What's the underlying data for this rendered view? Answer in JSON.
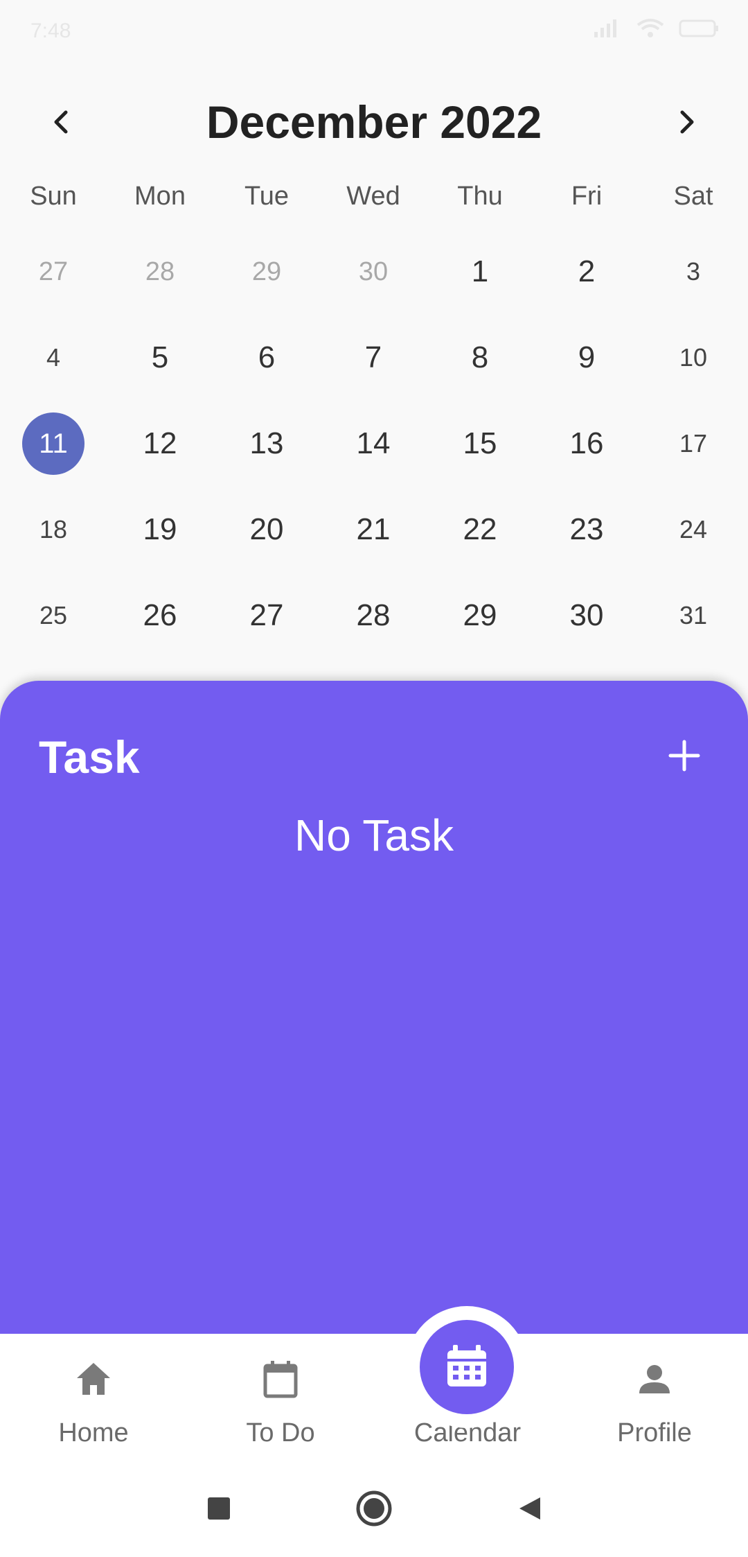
{
  "status_bar": {
    "time": "7:48",
    "icons": [
      "call-icon",
      "dots-icon",
      "signal-icon",
      "wifi-icon",
      "battery-icon"
    ]
  },
  "calendar": {
    "month_title": "December 2022",
    "weekdays": [
      "Sun",
      "Mon",
      "Tue",
      "Wed",
      "Thu",
      "Fri",
      "Sat"
    ],
    "weeks": [
      [
        "27",
        "28",
        "29",
        "30",
        "1",
        "2",
        "3"
      ],
      [
        "4",
        "5",
        "6",
        "7",
        "8",
        "9",
        "10"
      ],
      [
        "11",
        "12",
        "13",
        "14",
        "15",
        "16",
        "17"
      ],
      [
        "18",
        "19",
        "20",
        "21",
        "22",
        "23",
        "24"
      ],
      [
        "25",
        "26",
        "27",
        "28",
        "29",
        "30",
        "31"
      ]
    ],
    "selected_day": "11",
    "selected_color": "#5c6bc0"
  },
  "task_panel": {
    "title": "Task",
    "empty_text": "No Task",
    "background": "#735cf0"
  },
  "bottom_nav": {
    "items": [
      {
        "label": "Home",
        "icon": "home-icon"
      },
      {
        "label": "To Do",
        "icon": "todo-calendar-icon"
      },
      {
        "label": "Calendar",
        "icon": "calendar-icon"
      },
      {
        "label": "Profile",
        "icon": "person-icon"
      }
    ],
    "active_index": 2
  },
  "system_nav": {
    "icons": [
      "recents-square-icon",
      "home-circle-icon",
      "back-triangle-icon"
    ]
  }
}
